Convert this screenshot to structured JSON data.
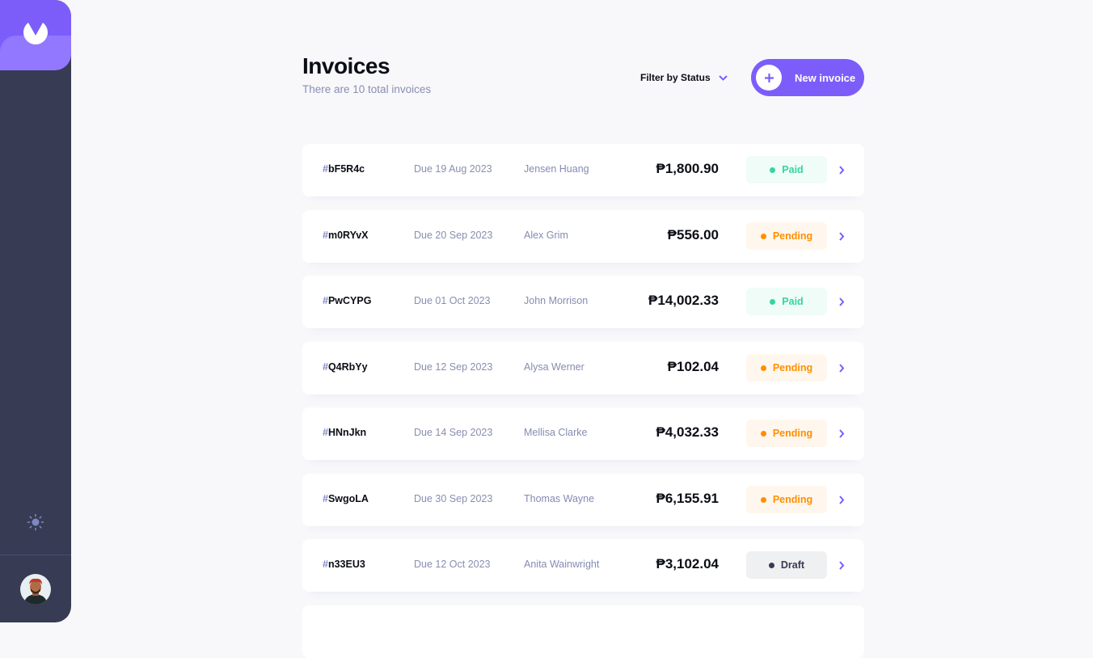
{
  "sidebar": {
    "logo_icon": "app-logo-icon",
    "theme_icon": "sun-icon",
    "avatar_icon": "user-avatar"
  },
  "header": {
    "title": "Invoices",
    "subtitle": "There are 10 total invoices",
    "filter_label": "Filter by Status",
    "new_invoice_label": "New invoice"
  },
  "colors": {
    "accent": "#7c5dfa",
    "sidebar": "#373b53",
    "paid": "#33d69f",
    "pending": "#ff8f00",
    "draft": "#373b53"
  },
  "invoices": [
    {
      "hash": "#",
      "id": "bF5R4c",
      "due": "Due 19 Aug 2023",
      "client": "Jensen Huang",
      "amount": "₱1,800.90",
      "status": "Paid",
      "status_key": "paid"
    },
    {
      "hash": "#",
      "id": "m0RYvX",
      "due": "Due 20 Sep 2023",
      "client": "Alex Grim",
      "amount": "₱556.00",
      "status": "Pending",
      "status_key": "pending"
    },
    {
      "hash": "#",
      "id": "PwCYPG",
      "due": "Due 01 Oct 2023",
      "client": "John Morrison",
      "amount": "₱14,002.33",
      "status": "Paid",
      "status_key": "paid"
    },
    {
      "hash": "#",
      "id": "Q4RbYy",
      "due": "Due 12 Sep 2023",
      "client": "Alysa Werner",
      "amount": "₱102.04",
      "status": "Pending",
      "status_key": "pending"
    },
    {
      "hash": "#",
      "id": "HNnJkn",
      "due": "Due 14 Sep 2023",
      "client": "Mellisa Clarke",
      "amount": "₱4,032.33",
      "status": "Pending",
      "status_key": "pending"
    },
    {
      "hash": "#",
      "id": "SwgoLA",
      "due": "Due 30 Sep 2023",
      "client": "Thomas Wayne",
      "amount": "₱6,155.91",
      "status": "Pending",
      "status_key": "pending"
    },
    {
      "hash": "#",
      "id": "n33EU3",
      "due": "Due 12 Oct 2023",
      "client": "Anita Wainwright",
      "amount": "₱3,102.04",
      "status": "Draft",
      "status_key": "draft"
    }
  ]
}
